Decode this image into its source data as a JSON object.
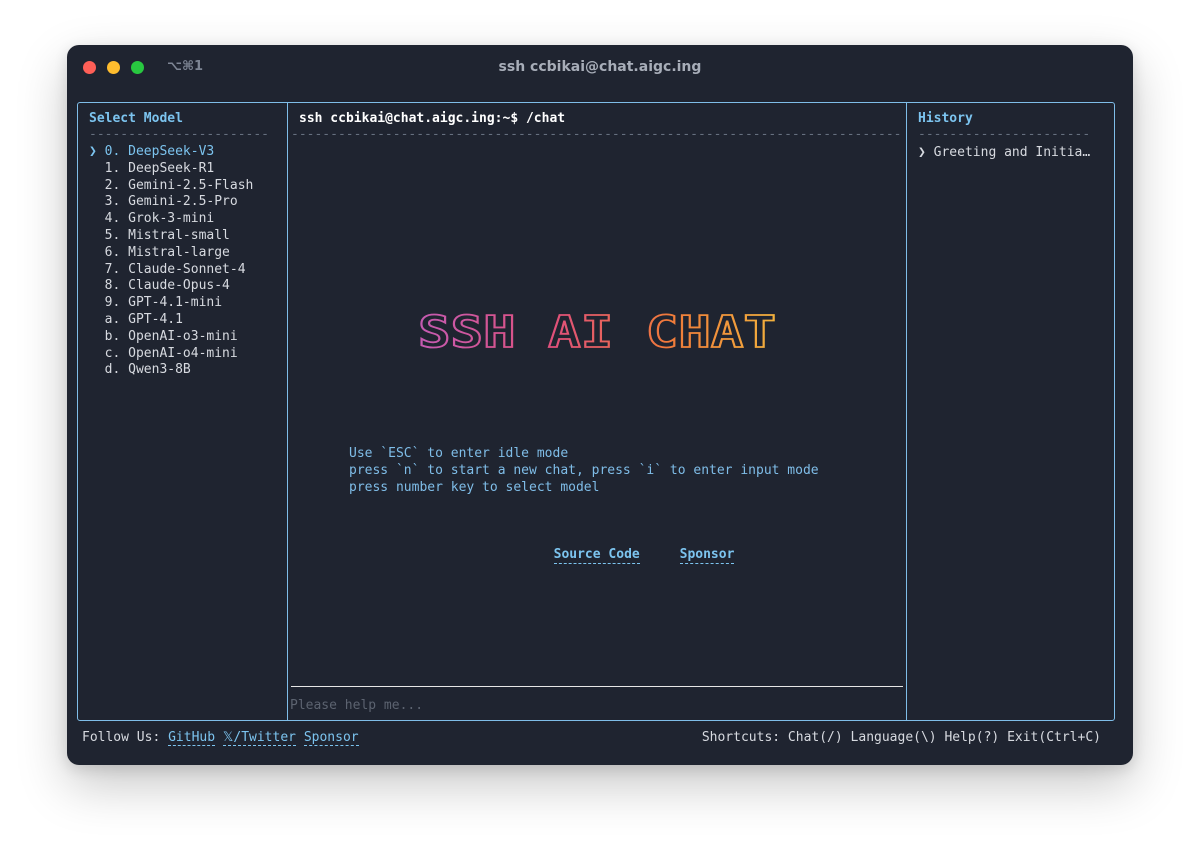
{
  "window": {
    "tab_shortcut": "⌥⌘1",
    "title": "ssh ccbikai@chat.aigc.ing"
  },
  "left_pane": {
    "heading": "Select Model",
    "rule": "-----------------------",
    "models": [
      {
        "label": "❯ 0. DeepSeek-V3",
        "selected": true
      },
      {
        "label": "  1. DeepSeek-R1"
      },
      {
        "label": "  2. Gemini-2.5-Flash"
      },
      {
        "label": "  3. Gemini-2.5-Pro"
      },
      {
        "label": "  4. Grok-3-mini"
      },
      {
        "label": "  5. Mistral-small"
      },
      {
        "label": "  6. Mistral-large"
      },
      {
        "label": "  7. Claude-Sonnet-4"
      },
      {
        "label": "  8. Claude-Opus-4"
      },
      {
        "label": "  9. GPT-4.1-mini"
      },
      {
        "label": "  a. GPT-4.1"
      },
      {
        "label": "  b. OpenAI-o3-mini"
      },
      {
        "label": "  c. OpenAI-o4-mini"
      },
      {
        "label": "  d. Qwen3-8B"
      }
    ]
  },
  "main": {
    "prompt": "ssh ccbikai@chat.aigc.ing:~$ /chat",
    "rule": "------------------------------------------------------------------------------",
    "logo_text": "SSH AI CHAT",
    "help_lines": [
      "Use `ESC` to enter idle mode",
      "press `n` to start a new chat, press `i` to enter input mode",
      "press number key to select model"
    ],
    "links": {
      "source_code": "Source Code",
      "sponsor": "Sponsor"
    },
    "input_placeholder": "Please help me..."
  },
  "right_pane": {
    "heading": "History",
    "rule": "----------------------",
    "items": [
      "❯ Greeting and Initia…"
    ]
  },
  "footer": {
    "follow_label": "Follow Us:",
    "links": [
      "GitHub",
      "𝕏/Twitter",
      "Sponsor"
    ],
    "shortcuts": "Shortcuts: Chat(/) Language(\\) Help(?) Exit(Ctrl+C)"
  },
  "colors": {
    "background": "#1f2430",
    "accent": "#7cc4ef",
    "logo_gradient": [
      "#c45bb3",
      "#e0507a",
      "#f07a3a",
      "#f2b23d"
    ]
  }
}
